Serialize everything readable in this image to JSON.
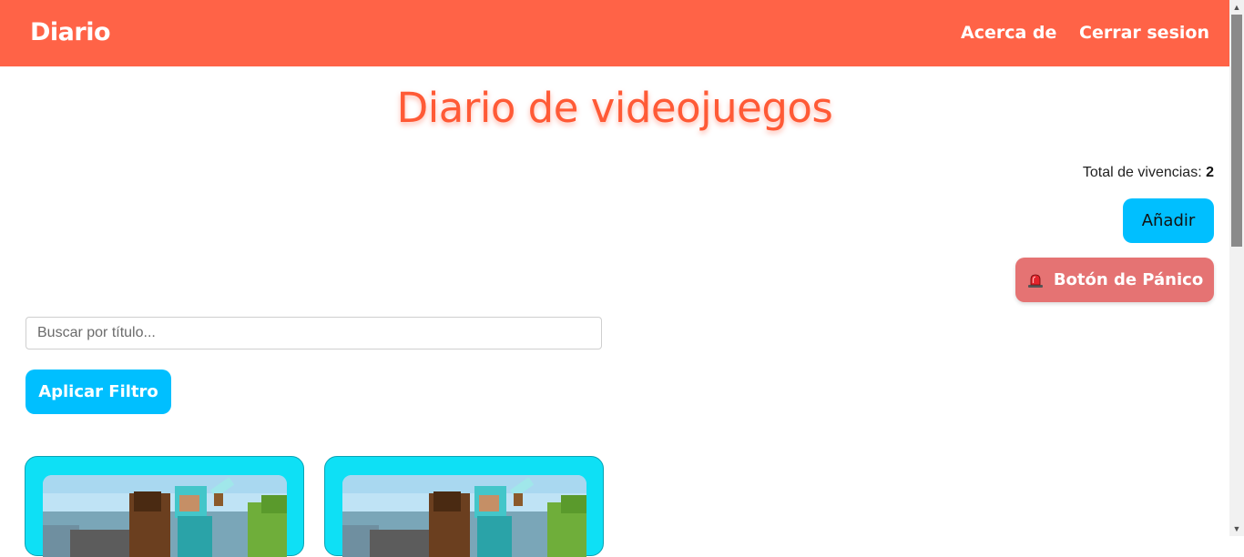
{
  "navbar": {
    "brand": "Diario",
    "links": [
      "Acerca de",
      "Cerrar sesion"
    ],
    "color": "#ff6347"
  },
  "main": {
    "title": "Diario de videojuegos",
    "total_label": "Total de vivencias: ",
    "total_value": "2",
    "add_button": "Añadir",
    "panic_button": "Botón de Pánico",
    "panic_icon": "siren-icon"
  },
  "filter": {
    "search_placeholder": "Buscar por título...",
    "search_value": "",
    "apply_button": "Aplicar Filtro"
  },
  "cards": [
    {
      "image": "minecraft-image"
    },
    {
      "image": "minecraft-image"
    }
  ],
  "colors": {
    "accent": "#00bfff",
    "panic": "#e57373",
    "card": "#0ee0f5",
    "title": "#ff5a36"
  }
}
